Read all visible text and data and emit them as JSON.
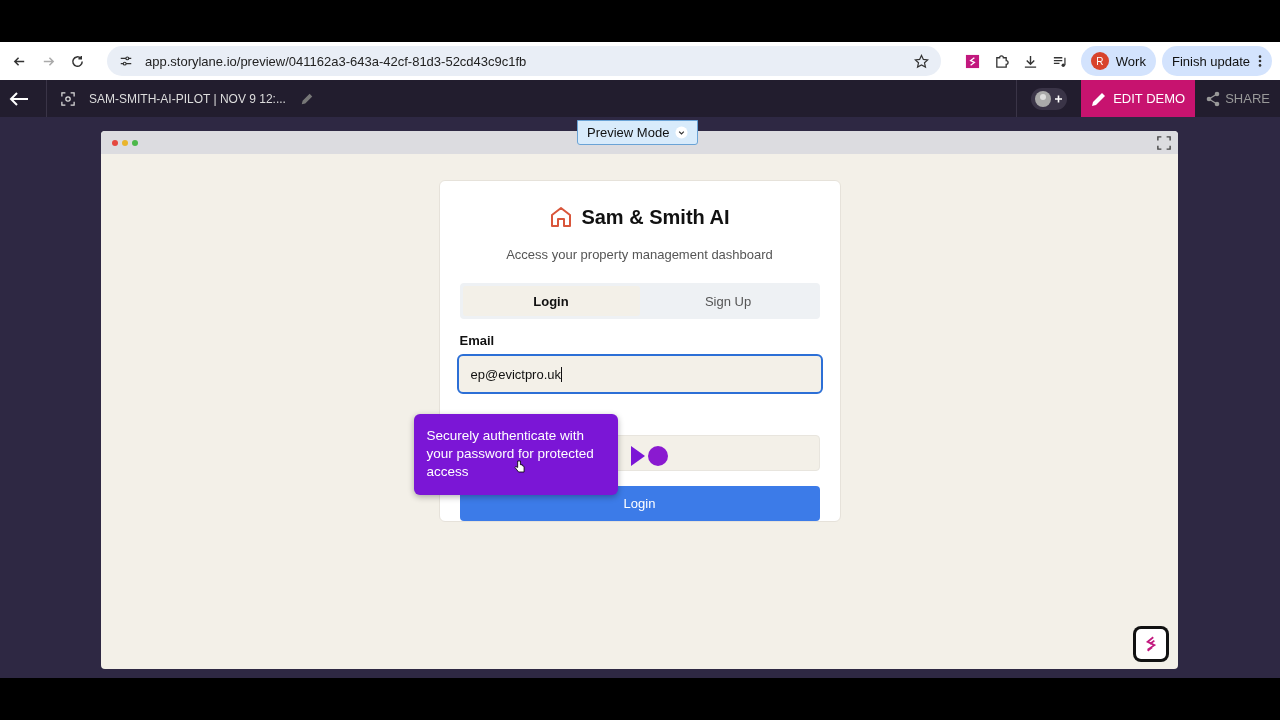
{
  "browser": {
    "url": "app.storylane.io/preview/041162a3-643a-42cf-81d3-52cd43c9c1fb",
    "profile_initial": "R",
    "profile_label": "Work",
    "update_button": "Finish update"
  },
  "editor": {
    "title": "SAM-SMITH-AI-PILOT | NOV 9 12:...",
    "edit_button": "EDIT DEMO",
    "share_button": "SHARE",
    "preview_mode": "Preview Mode"
  },
  "login": {
    "brand": "Sam & Smith AI",
    "subtitle": "Access your property management dashboard",
    "tabs": [
      {
        "label": "Login",
        "selected": true
      },
      {
        "label": "Sign Up",
        "selected": false
      }
    ],
    "email": {
      "label": "Email",
      "value": "ep@evictpro.uk"
    },
    "submit": "Login"
  },
  "tooltip": {
    "text": "Securely authenticate with your password for protected access"
  }
}
